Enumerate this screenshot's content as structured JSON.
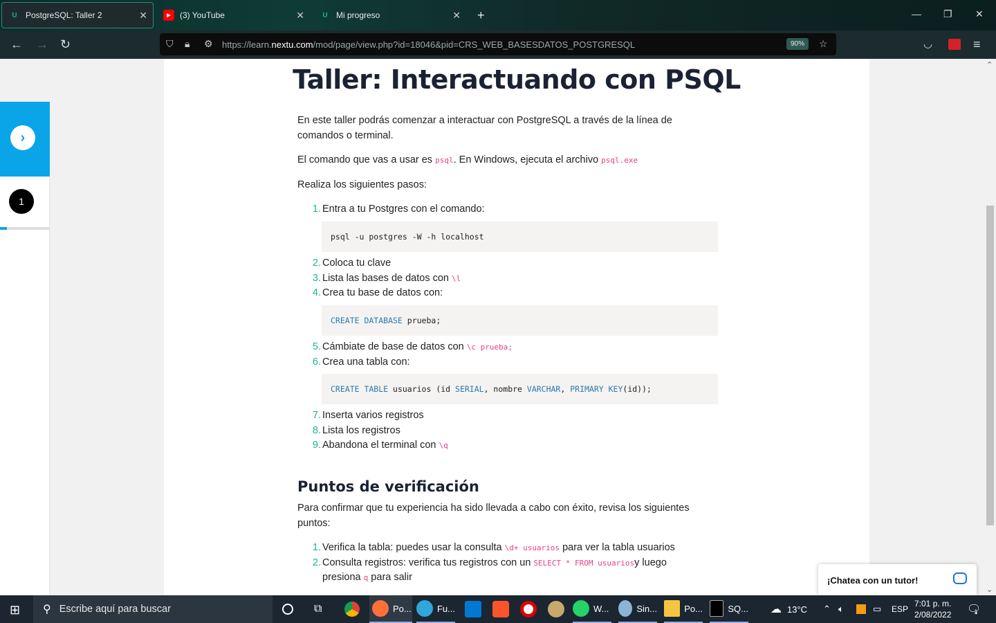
{
  "browser": {
    "tabs": [
      {
        "label": "PostgreSQL: Taller 2",
        "favicon": "nextu-icon",
        "active": true
      },
      {
        "label": "(3) YouTube",
        "favicon": "youtube-icon",
        "active": false
      },
      {
        "label": "Mi progreso",
        "favicon": "nextu-icon",
        "active": false
      }
    ],
    "url_prefix": "https://learn.",
    "url_domain": "nextu.com",
    "url_path": "/mod/page/view.php?id=18046&pid=CRS_WEB_BASESDATOS_POSTGRESQL",
    "zoom": "90%"
  },
  "sidebar": {
    "step": "1",
    "progress_fraction": 0.14
  },
  "article": {
    "title": "Taller: Interactuando con PSQL",
    "intro": "En este taller podrás comenzar a interactuar con PostgreSQL a través de la línea de comandos o terminal.",
    "cmd_prefix": "El comando que vas a usar es ",
    "cmd_psql": "psql",
    "cmd_mid": ". En Windows, ejecuta el archivo ",
    "cmd_exe": "psql.exe",
    "steps_intro": "Realiza los siguientes pasos:",
    "steps": [
      {
        "num": "1.",
        "text": "Entra a tu Postgres con el comando:"
      },
      {
        "num": "2.",
        "text": "Coloca tu clave"
      },
      {
        "num": "3.",
        "text": "Lista las bases de datos con ",
        "code": "\\l"
      },
      {
        "num": "4.",
        "text": "Crea tu base de datos con:"
      },
      {
        "num": "5.",
        "text": "Cámbiate de base de datos con ",
        "code": "\\c prueba;"
      },
      {
        "num": "6.",
        "text": "Crea una tabla con:"
      },
      {
        "num": "7.",
        "text": "Inserta varios registros"
      },
      {
        "num": "8.",
        "text": "Lista los registros"
      },
      {
        "num": "9.",
        "text": "Abandona el terminal con ",
        "code": "\\q"
      }
    ],
    "code1": "psql -u postgres -W -h localhost",
    "code2_kw": "CREATE DATABASE",
    "code2_rest": " prueba;",
    "code3_kw1": "CREATE TABLE",
    "code3_a": " usuarios (id ",
    "code3_kw2": "SERIAL",
    "code3_b": ", nombre ",
    "code3_kw3": "VARCHAR",
    "code3_c": ", ",
    "code3_kw4": "PRIMARY KEY",
    "code3_d": "(id));",
    "verify_title": "Puntos de verificación",
    "verify_intro": "Para confirmar que tu experiencia ha sido llevada a cabo con éxito, revisa los siguientes puntos:",
    "verify": [
      {
        "num": "1.",
        "a": "Verifica la tabla: puedes usar la consulta ",
        "code": "\\d+ usuarios",
        "b": " para ver la tabla usuarios"
      },
      {
        "num": "2.",
        "a": "Consulta registros: verifica tus registros con un ",
        "code": "SELECT * FROM usuarios",
        "b": "y luego presiona ",
        "code2": "q",
        "c": " para salir"
      }
    ]
  },
  "chat": {
    "label": "¡Chatea con un tutor!"
  },
  "taskbar": {
    "search_placeholder": "Escribe aquí para buscar",
    "apps": [
      {
        "label": "Po...",
        "icon": "firefox-icon"
      },
      {
        "label": "Fu...",
        "icon": "edge-icon"
      },
      {
        "label": "W...",
        "icon": "whatsapp-icon"
      },
      {
        "label": "Sin...",
        "icon": "paint-icon"
      },
      {
        "label": "Po...",
        "icon": "folder-icon"
      },
      {
        "label": "SQ...",
        "icon": "terminal-icon"
      }
    ],
    "weather": "13°C",
    "lang": "ESP",
    "time": "7:01 p. m.",
    "date": "2/08/2022",
    "notif_count": "1"
  }
}
